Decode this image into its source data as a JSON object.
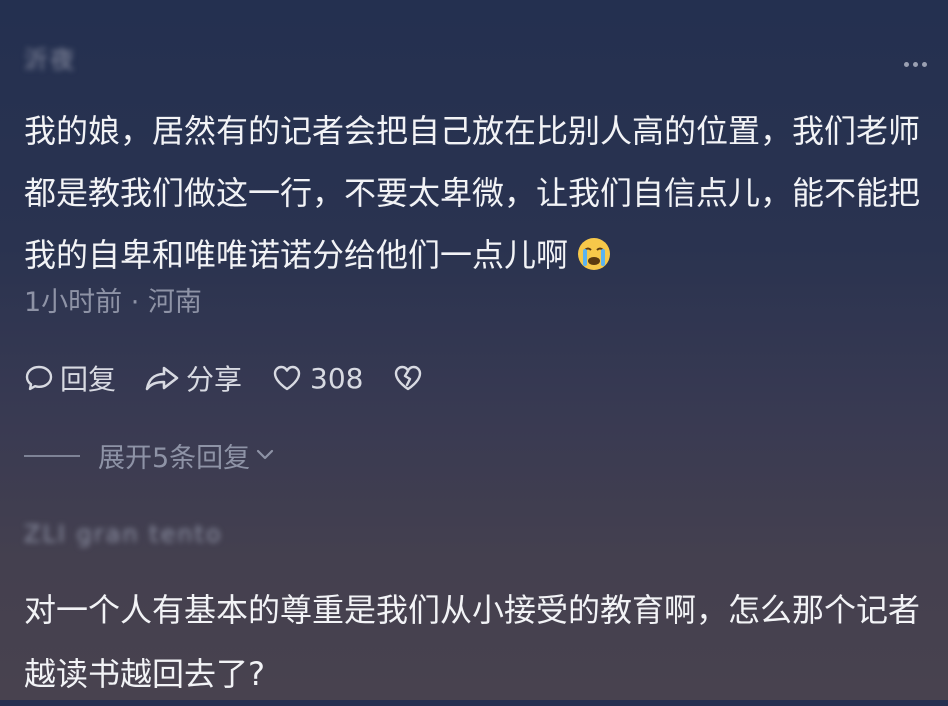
{
  "comment1": {
    "username": "沂夜",
    "text": "我的娘，居然有的记者会把自己放在比别人高的位置，我们老师都是教我们做这一行，不要太卑微，让我们自信点儿，能不能把我的自卑和唯唯诺诺分给他们一点儿啊",
    "emoji_icon": "crying-face-icon",
    "meta": "1小时前 · 河南",
    "actions": {
      "reply_label": "回复",
      "share_label": "分享",
      "like_count": "308"
    },
    "expand_label": "展开5条回复"
  },
  "comment2": {
    "username": "ZLI gran tento",
    "text": "对一个人有基本的尊重是我们从小接受的教育啊，怎么那个记者越读书越回去了?"
  },
  "colors": {
    "background_top": "#243050",
    "background_bottom": "#48424f",
    "text_primary": "#f2f3f6",
    "text_secondary": "#8e93a6"
  }
}
